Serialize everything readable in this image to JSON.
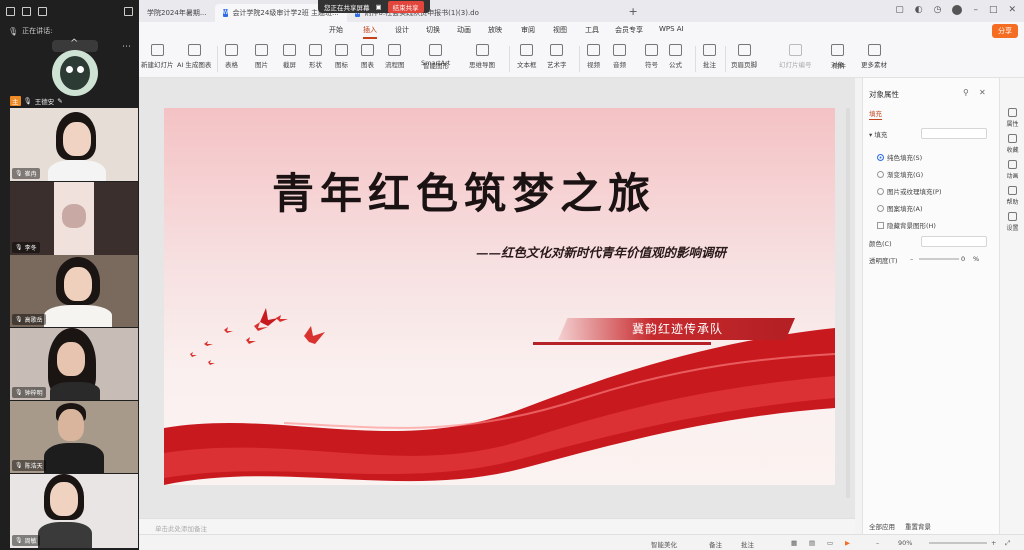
{
  "meeting": {
    "speaking_label": "正在讲话:",
    "host_name": "王德安",
    "participants": [
      {
        "name": "崔冉"
      },
      {
        "name": "李冬"
      },
      {
        "name": "高歌岳"
      },
      {
        "name": "钟梓明"
      },
      {
        "name": "陈浩天"
      },
      {
        "name": "周敏"
      }
    ]
  },
  "tabs": [
    {
      "label": "学院2024年暑期..."
    },
    {
      "label": "会计学院24级审计学2班 主题班..."
    },
    {
      "label": "附件6.社会实践队员申报书(1)(3).do..."
    }
  ],
  "share_strip": {
    "text": "您正在共享屏幕",
    "stop": "结束共享"
  },
  "menu": {
    "items": [
      "开始",
      "插入",
      "设计",
      "切换",
      "动画",
      "放映",
      "审阅",
      "视图",
      "工具",
      "会员专享",
      "WPS AI"
    ],
    "active": "插入",
    "share_button": "分享"
  },
  "toolbar": {
    "items": [
      "新建幻灯片",
      "AI 生成图表",
      "表格",
      "图片",
      "截屏",
      "形状",
      "图标",
      "图表",
      "流程图",
      "SmartArt",
      "智能图形",
      "思维导图",
      "文本框",
      "艺术字",
      "视频",
      "音频",
      "符号",
      "公式",
      "批注",
      "页眉页脚",
      "幻灯片编号",
      "对象",
      "附件",
      "更多素材"
    ]
  },
  "slide": {
    "title": "青年红色筑梦之旅",
    "subtitle": "——红色文化对新时代青年价值观的影响调研",
    "team": "冀韵红迹传承队"
  },
  "notes_placeholder": "单击此处添加备注",
  "status": {
    "smart_beautify": "智能美化",
    "notes": "备注",
    "annotation": "批注",
    "zoom": "90%"
  },
  "properties": {
    "header": "对象属性",
    "tab": "填充",
    "section": "填充",
    "options": [
      "纯色填充(S)",
      "渐变填充(G)",
      "图片或纹理填充(P)",
      "图案填充(A)",
      "隐藏背景图形(H)"
    ],
    "selected_option": "纯色填充(S)",
    "color_label": "颜色(C)",
    "transparency_label": "透明度(T)",
    "transparency_value": "0",
    "transparency_unit": "%",
    "apply_all": "全部应用",
    "reset": "重置背景"
  },
  "sidebar": {
    "items": [
      "属性",
      "收藏",
      "动画",
      "帮助",
      "设置"
    ]
  },
  "colors": {
    "accent": "#c4431b",
    "share_orange": "#f56d22",
    "slide_red": "#c62a2d"
  }
}
